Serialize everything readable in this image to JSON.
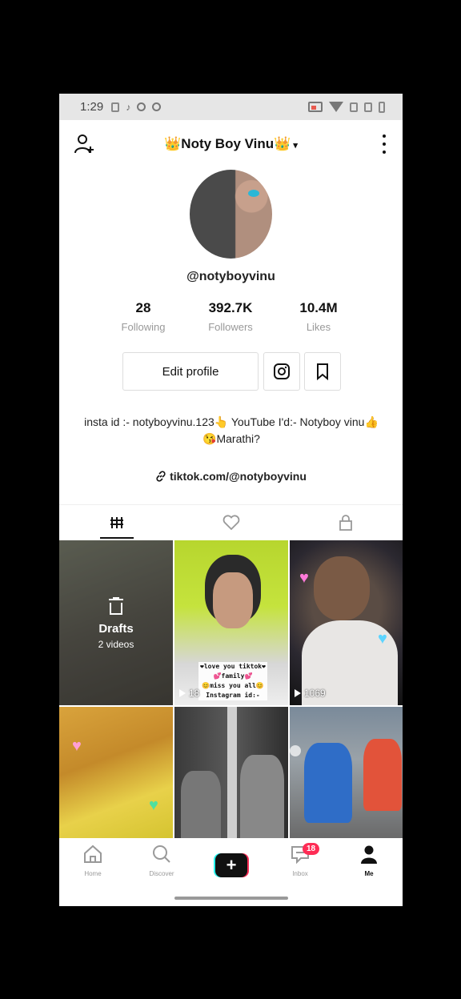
{
  "status_bar": {
    "time": "1:29"
  },
  "header": {
    "title": "👑Noty Boy Vinu👑",
    "caret": "▾"
  },
  "profile": {
    "handle": "@notyboyvinu",
    "stats": [
      {
        "value": "28",
        "label": "Following"
      },
      {
        "value": "392.7K",
        "label": "Followers"
      },
      {
        "value": "10.4M",
        "label": "Likes"
      }
    ],
    "edit_label": "Edit profile",
    "bio_line1": "insta id :- notyboyvinu.123👆 YouTube I'd:- Notyboy vinu👍",
    "bio_line2": "😘Marathi?",
    "link": "tiktok.com/@notyboyvinu"
  },
  "grid": {
    "drafts_title": "Drafts",
    "drafts_sub": "2 videos",
    "video2_views": "18",
    "video2_caption": [
      "❤love you tiktok❤",
      "💕family💕",
      "😊miss you all😊",
      "Instagram id:-"
    ],
    "video3_views": "1069"
  },
  "bottom_nav": {
    "items": [
      {
        "label": "Home",
        "icon": "home-icon"
      },
      {
        "label": "Discover",
        "icon": "search-icon"
      },
      {
        "label": "",
        "icon": "plus-icon"
      },
      {
        "label": "Inbox",
        "icon": "inbox-icon"
      },
      {
        "label": "Me",
        "icon": "person-icon"
      }
    ],
    "inbox_badge": "18"
  },
  "colors": {
    "accent_pink": "#fe2c55",
    "accent_cyan": "#25f4ee"
  }
}
